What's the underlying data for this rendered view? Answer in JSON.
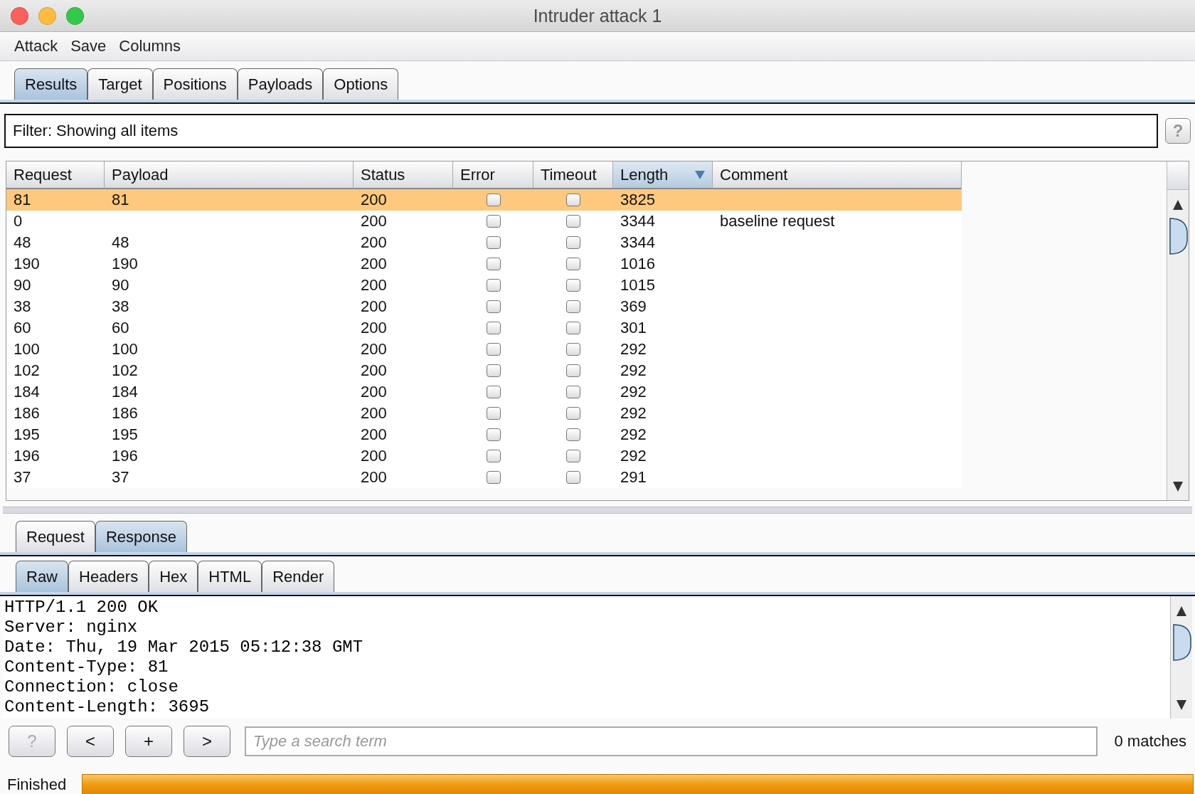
{
  "window": {
    "title": "Intruder attack 1"
  },
  "menu": [
    "Attack",
    "Save",
    "Columns"
  ],
  "tabs": [
    {
      "label": "Results",
      "selected": true
    },
    {
      "label": "Target",
      "selected": false
    },
    {
      "label": "Positions",
      "selected": false
    },
    {
      "label": "Payloads",
      "selected": false
    },
    {
      "label": "Options",
      "selected": false
    }
  ],
  "filter": {
    "text": "Filter: Showing all items",
    "help": "?"
  },
  "table": {
    "columns": [
      {
        "label": "Request",
        "sorted": false
      },
      {
        "label": "Payload",
        "sorted": false
      },
      {
        "label": "Status",
        "sorted": false
      },
      {
        "label": "Error",
        "sorted": false
      },
      {
        "label": "Timeout",
        "sorted": false
      },
      {
        "label": "Length",
        "sorted": true
      },
      {
        "label": "Comment",
        "sorted": false
      }
    ],
    "rows": [
      {
        "request": "81",
        "payload": "81",
        "status": "200",
        "error": false,
        "timeout": false,
        "length": "3825",
        "comment": "",
        "selected": true
      },
      {
        "request": "0",
        "payload": "",
        "status": "200",
        "error": false,
        "timeout": false,
        "length": "3344",
        "comment": "baseline request",
        "selected": false
      },
      {
        "request": "48",
        "payload": "48",
        "status": "200",
        "error": false,
        "timeout": false,
        "length": "3344",
        "comment": "",
        "selected": false
      },
      {
        "request": "190",
        "payload": "190",
        "status": "200",
        "error": false,
        "timeout": false,
        "length": "1016",
        "comment": "",
        "selected": false
      },
      {
        "request": "90",
        "payload": "90",
        "status": "200",
        "error": false,
        "timeout": false,
        "length": "1015",
        "comment": "",
        "selected": false
      },
      {
        "request": "38",
        "payload": "38",
        "status": "200",
        "error": false,
        "timeout": false,
        "length": "369",
        "comment": "",
        "selected": false
      },
      {
        "request": "60",
        "payload": "60",
        "status": "200",
        "error": false,
        "timeout": false,
        "length": "301",
        "comment": "",
        "selected": false
      },
      {
        "request": "100",
        "payload": "100",
        "status": "200",
        "error": false,
        "timeout": false,
        "length": "292",
        "comment": "",
        "selected": false
      },
      {
        "request": "102",
        "payload": "102",
        "status": "200",
        "error": false,
        "timeout": false,
        "length": "292",
        "comment": "",
        "selected": false
      },
      {
        "request": "184",
        "payload": "184",
        "status": "200",
        "error": false,
        "timeout": false,
        "length": "292",
        "comment": "",
        "selected": false
      },
      {
        "request": "186",
        "payload": "186",
        "status": "200",
        "error": false,
        "timeout": false,
        "length": "292",
        "comment": "",
        "selected": false
      },
      {
        "request": "195",
        "payload": "195",
        "status": "200",
        "error": false,
        "timeout": false,
        "length": "292",
        "comment": "",
        "selected": false
      },
      {
        "request": "196",
        "payload": "196",
        "status": "200",
        "error": false,
        "timeout": false,
        "length": "292",
        "comment": "",
        "selected": false
      },
      {
        "request": "37",
        "payload": "37",
        "status": "200",
        "error": false,
        "timeout": false,
        "length": "291",
        "comment": "",
        "selected": false
      }
    ]
  },
  "message_tabs": [
    {
      "label": "Request",
      "selected": false
    },
    {
      "label": "Response",
      "selected": true
    }
  ],
  "view_tabs": [
    {
      "label": "Raw",
      "selected": true
    },
    {
      "label": "Headers",
      "selected": false
    },
    {
      "label": "Hex",
      "selected": false
    },
    {
      "label": "HTML",
      "selected": false
    },
    {
      "label": "Render",
      "selected": false
    }
  ],
  "response_lines": [
    "HTTP/1.1 200 OK",
    "Server: nginx",
    "Date: Thu, 19 Mar 2015 05:12:38 GMT",
    "Content-Type: 81",
    "Connection: close",
    "Content-Length: 3695"
  ],
  "search_bar": {
    "buttons": [
      "?",
      "<",
      "+",
      ">"
    ],
    "placeholder": "Type a search term",
    "matches": "0 matches"
  },
  "status_bar": {
    "text": "Finished",
    "level": 1
  }
}
